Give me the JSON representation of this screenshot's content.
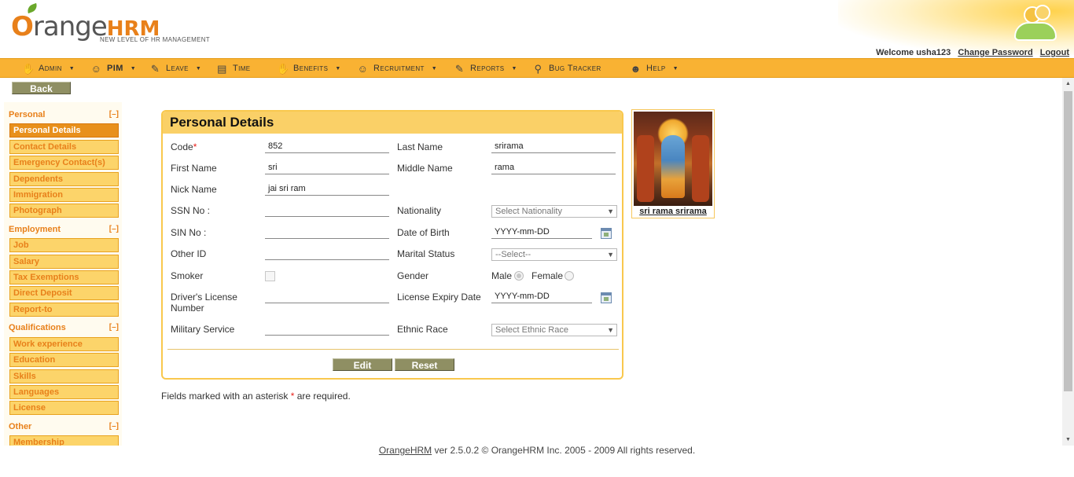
{
  "header": {
    "logo_word": "range",
    "logo_o": "O",
    "logo_hrm": "HRM",
    "logo_tagline": "NEW LEVEL OF HR MANAGEMENT",
    "welcome": "Welcome usha123",
    "change_password": "Change Password",
    "logout": "Logout"
  },
  "menu": [
    {
      "label": "Admin",
      "icon": "admin-icon"
    },
    {
      "label": "PIM",
      "icon": "pim-icon"
    },
    {
      "label": "Leave",
      "icon": "leave-icon"
    },
    {
      "label": "Time",
      "icon": "time-icon"
    },
    {
      "label": "Benefits",
      "icon": "benefits-icon"
    },
    {
      "label": "Recruitment",
      "icon": "recruitment-icon"
    },
    {
      "label": "Reports",
      "icon": "reports-icon"
    },
    {
      "label": "Bug Tracker",
      "icon": "bug-tracker-icon"
    },
    {
      "label": "Help",
      "icon": "help-icon"
    }
  ],
  "back_label": "Back",
  "sidebar": {
    "toggle": "[–]",
    "personal": {
      "title": "Personal",
      "items": [
        "Personal Details",
        "Contact Details",
        "Emergency Contact(s)",
        "Dependents",
        "Immigration",
        "Photograph"
      ]
    },
    "employment": {
      "title": "Employment",
      "items": [
        "Job",
        "Salary",
        "Tax Exemptions",
        "Direct Deposit",
        "Report-to"
      ]
    },
    "qualifications": {
      "title": "Qualifications",
      "items": [
        "Work experience",
        "Education",
        "Skills",
        "Languages",
        "License"
      ]
    },
    "other": {
      "title": "Other",
      "items": [
        "Membership"
      ]
    }
  },
  "panel": {
    "title": "Personal Details",
    "labels": {
      "code": "Code",
      "last_name": "Last Name",
      "first_name": "First Name",
      "middle_name": "Middle Name",
      "nick_name": "Nick Name",
      "ssn": "SSN No :",
      "nationality": "Nationality",
      "sin": "SIN No :",
      "dob": "Date of Birth",
      "other_id": "Other ID",
      "marital": "Marital Status",
      "smoker": "Smoker",
      "gender": "Gender",
      "license_line1": "Driver's License",
      "license_line2": "Number",
      "license_expiry": "License Expiry Date",
      "military": "Military Service",
      "ethnic": "Ethnic Race",
      "male": "Male",
      "female": "Female",
      "asterisk": "*"
    },
    "values": {
      "code": "852",
      "last_name": "srirama",
      "first_name": "sri",
      "middle_name": "rama",
      "nick_name": "jai sri ram",
      "ssn": "",
      "sin": "",
      "other_id": "",
      "license_number": "",
      "military": "",
      "dob": "YYYY-mm-DD",
      "license_expiry": "YYYY-mm-DD",
      "nationality": "Select Nationality",
      "marital": "--Select--",
      "ethnic": "Select Ethnic Race"
    },
    "edit_label": "Edit",
    "reset_label": "Reset"
  },
  "photo_caption": "sri rama srirama",
  "required_note": {
    "before": "Fields marked with an asterisk ",
    "star": "*",
    "after": " are required."
  },
  "footer": {
    "link": "OrangeHRM",
    "text": " ver 2.5.0.2 © OrangeHRM Inc. 2005 - 2009 All rights reserved."
  },
  "colors": {
    "menu_bar": "#f9b233",
    "accent_orange": "#e8801a",
    "panel_header": "#fad067",
    "button_olive": "#8f8f63"
  }
}
